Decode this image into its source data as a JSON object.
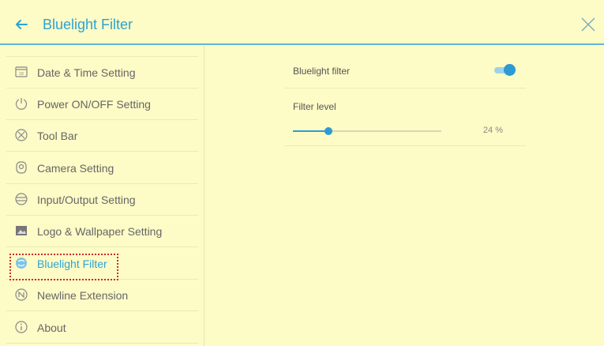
{
  "header": {
    "title": "Bluelight Filter",
    "back_icon": "back-arrow-icon",
    "close_icon": "close-icon",
    "accent": "#2ea3d1"
  },
  "sidebar": {
    "items": [
      {
        "label": "Date & Time Setting",
        "icon": "calendar-icon"
      },
      {
        "label": "Power ON/OFF Setting",
        "icon": "power-icon"
      },
      {
        "label": "Tool Bar",
        "icon": "toolbar-icon"
      },
      {
        "label": "Camera Setting",
        "icon": "camera-icon"
      },
      {
        "label": "Input/Output Setting",
        "icon": "input-output-icon"
      },
      {
        "label": "Logo & Wallpaper Setting",
        "icon": "image-icon"
      },
      {
        "label": "Bluelight Filter",
        "icon": "bluelight-icon",
        "active": true
      },
      {
        "label": "Newline Extension",
        "icon": "newline-icon"
      },
      {
        "label": "About",
        "icon": "info-icon"
      }
    ]
  },
  "settings": {
    "bluelight_filter_label": "Bluelight filter",
    "bluelight_filter_enabled": true,
    "filter_level_label": "Filter level",
    "filter_level_value": 24,
    "filter_level_text": "24 %"
  },
  "colors": {
    "background": "#fdfbc6",
    "accent": "#2e9ad3",
    "highlight": "#d12a2a"
  }
}
